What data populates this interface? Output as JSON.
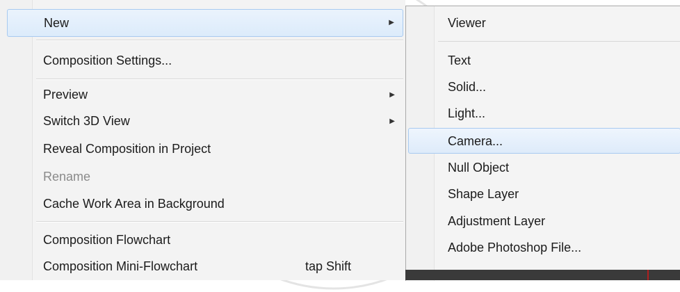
{
  "main_menu": {
    "items": [
      {
        "label": "New",
        "has_submenu": true,
        "selected": true
      },
      {
        "label": "Composition Settings..."
      },
      {
        "label": "Preview",
        "has_submenu": true
      },
      {
        "label": "Switch 3D View",
        "has_submenu": true
      },
      {
        "label": "Reveal Composition in Project"
      },
      {
        "label": "Rename",
        "disabled": true
      },
      {
        "label": "Cache Work Area in Background"
      },
      {
        "label": "Composition Flowchart"
      },
      {
        "label": "Composition Mini-Flowchart",
        "shortcut": "tap Shift"
      }
    ]
  },
  "submenu": {
    "items": [
      {
        "label": "Viewer"
      },
      {
        "label": "Text"
      },
      {
        "label": "Solid..."
      },
      {
        "label": "Light..."
      },
      {
        "label": "Camera...",
        "selected": true
      },
      {
        "label": "Null Object"
      },
      {
        "label": "Shape Layer"
      },
      {
        "label": "Adjustment Layer"
      },
      {
        "label": "Adobe Photoshop File..."
      }
    ]
  },
  "icons": {
    "submenu_arrow": "triangle-right-icon",
    "watermark": "university-seal-watermark"
  },
  "colors": {
    "highlight_border": "#a8caf0",
    "highlight_fill": "#dcebfb",
    "menu_bg": "#f3f3f3",
    "disabled_text": "#8a8a8a"
  }
}
